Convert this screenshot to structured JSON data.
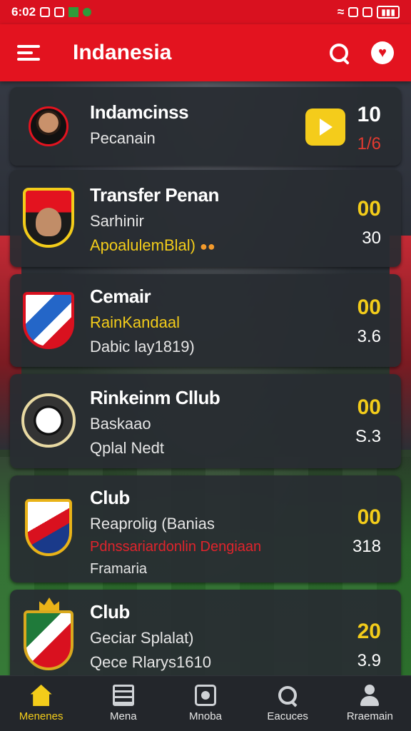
{
  "status_bar": {
    "time": "6:02"
  },
  "app_bar": {
    "title": "Indanesia"
  },
  "cards": [
    {
      "name": "Indamcinss",
      "line1": "Pecanain",
      "score_a": "10",
      "score_b": "1/6"
    },
    {
      "name": "Transfer Penan",
      "line1": "Sarhinir",
      "line2": "ApoalulemBlal)",
      "score_a": "00",
      "score_b": "30"
    },
    {
      "name": "Cemair",
      "line1": "RainKandaal",
      "line2": "Dabic lay1819)",
      "score_a": "00",
      "score_b": "3.6"
    },
    {
      "name": "Rinkeinm Cllub",
      "line1": "Baskaao",
      "line2": "Qplal Nedt",
      "score_a": "00",
      "score_b": "S.3"
    },
    {
      "name": "Club",
      "line1": "Reaprolig (Banias",
      "line2": "Pdnssariardonlin Dengiaan",
      "line3": "Framaria",
      "score_a": "00",
      "score_b": "318"
    },
    {
      "name": "Club",
      "line1": "Geciar Splalat)",
      "line2": "Qece Rlarys1610",
      "score_a": "20",
      "score_b": "3.9"
    }
  ],
  "bottom_nav": [
    {
      "label": "Menenes",
      "icon": "home-icon",
      "active": true
    },
    {
      "label": "Mena",
      "icon": "news-icon",
      "active": false
    },
    {
      "label": "Mnoba",
      "icon": "media-icon",
      "active": false
    },
    {
      "label": "Eacuces",
      "icon": "explore-icon",
      "active": false
    },
    {
      "label": "Rraemain",
      "icon": "profile-icon",
      "active": false
    }
  ],
  "colors": {
    "brand_red": "#e3131f",
    "accent_yellow": "#f3cc1a",
    "card_bg": "#282c32"
  }
}
